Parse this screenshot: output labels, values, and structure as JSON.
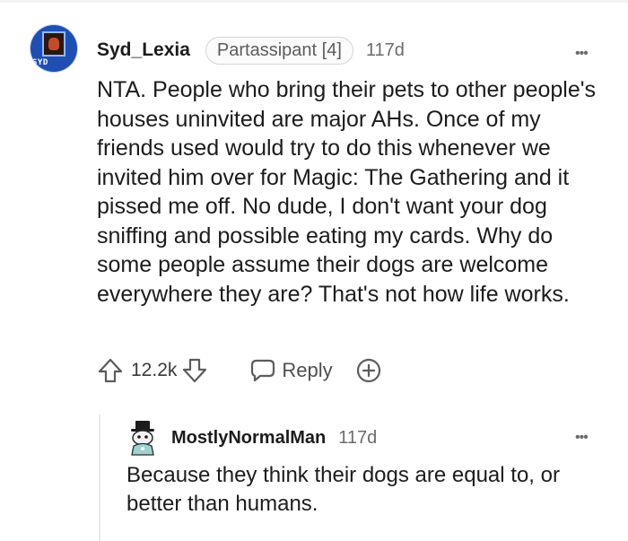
{
  "comment": {
    "avatar_icon": "pixel-art-avatar-icon",
    "avatar_text": "SYD",
    "username": "Syd_Lexia",
    "flair": "Partassipant [4]",
    "age": "117d",
    "more_icon": "•••",
    "body": "NTA. People who bring their pets to other people's houses uninvited are major AHs. Once of my friends used would try to do this whenever we invited him over for Magic: The Gathering and it pissed me off. No dude, I don't want your dog sniffing and possible eating my cards. Why do some people assume their dogs are welcome everywhere they are? That's not how life works.",
    "score": "12.2k",
    "reply_label": "Reply",
    "icons": [
      "upvote-arrow-icon",
      "downvote-arrow-icon",
      "speech-bubble-icon",
      "plus-circle-award-icon"
    ]
  },
  "reply": {
    "avatar_icon": "snoo-top-hat-avatar-icon",
    "username": "MostlyNormalMan",
    "age": "117d",
    "more_icon": "•••",
    "body": "Because they think their dogs are equal to, or better than humans."
  },
  "colors": {
    "text": "#1c1c1c",
    "meta": "#6b6b6b",
    "icon": "#5c5c5c",
    "flair_border": "#d5d5d5",
    "thread_line": "#e9e9e9"
  }
}
